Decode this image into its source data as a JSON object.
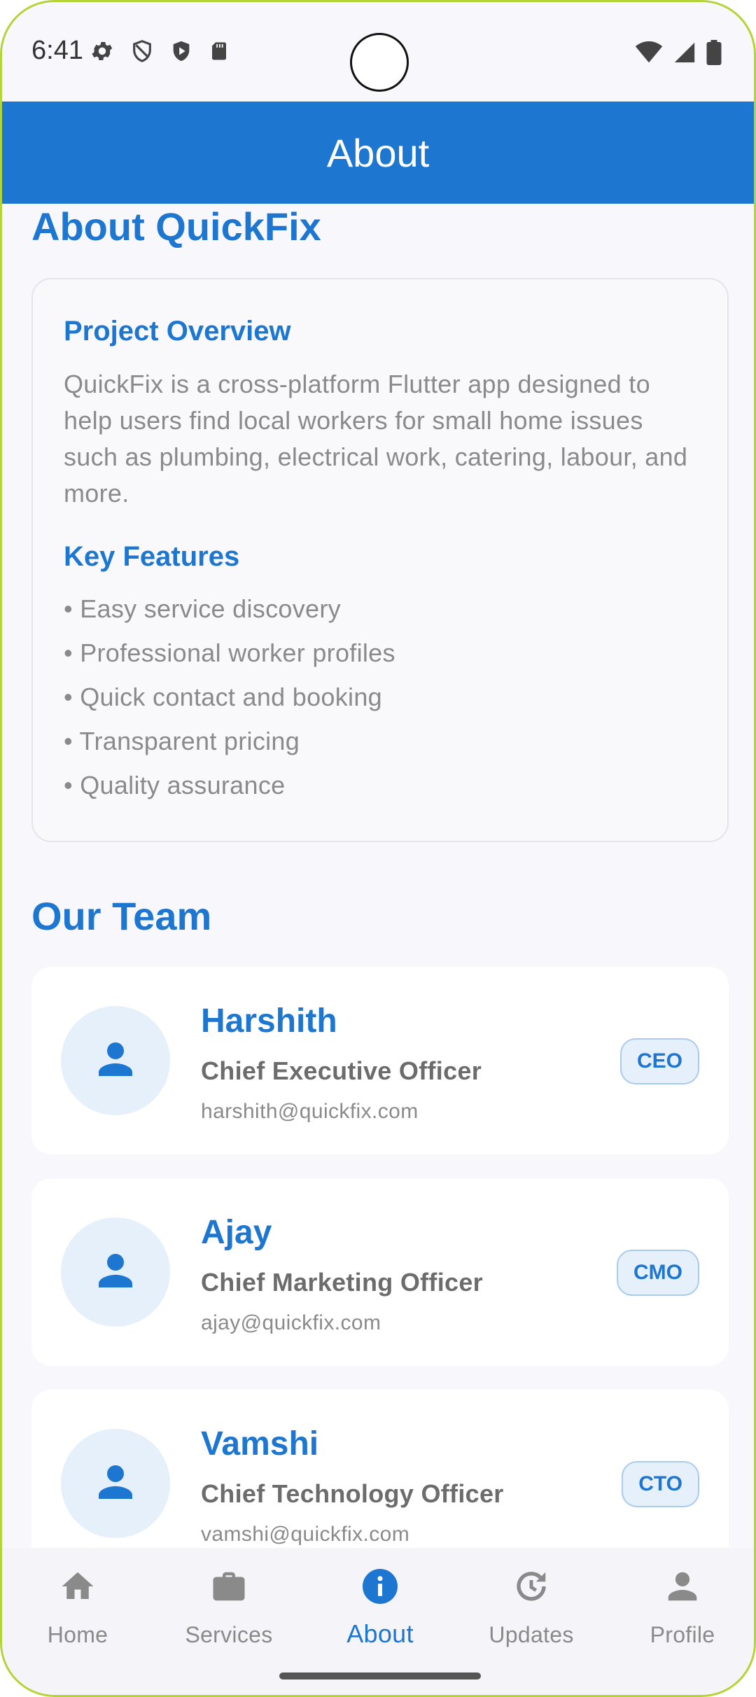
{
  "status_bar": {
    "time": "6:41"
  },
  "app_bar": {
    "title": "About"
  },
  "about": {
    "title": "About QuickFix",
    "overview_heading": "Project Overview",
    "overview_text": "QuickFix is a cross-platform Flutter app designed to help users find local workers for small home issues such as plumbing, electrical work, catering, labour, and more.",
    "features_heading": "Key Features",
    "features": [
      "• Easy service discovery",
      "• Professional worker profiles",
      "• Quick contact and booking",
      "• Transparent pricing",
      "• Quality assurance"
    ]
  },
  "team": {
    "title": "Our Team",
    "members": [
      {
        "name": "Harshith",
        "role": "Chief Executive Officer",
        "email": "harshith@quickfix.com",
        "badge": "CEO"
      },
      {
        "name": "Ajay",
        "role": "Chief Marketing Officer",
        "email": "ajay@quickfix.com",
        "badge": "CMO"
      },
      {
        "name": "Vamshi",
        "role": "Chief Technology Officer",
        "email": "vamshi@quickfix.com",
        "badge": "CTO"
      }
    ]
  },
  "bottom_nav": {
    "active": "About",
    "items": [
      {
        "label": "Home",
        "icon": "home-icon"
      },
      {
        "label": "Services",
        "icon": "briefcase-icon"
      },
      {
        "label": "About",
        "icon": "info-icon"
      },
      {
        "label": "Updates",
        "icon": "update-icon"
      },
      {
        "label": "Profile",
        "icon": "person-icon"
      }
    ]
  },
  "colors": {
    "primary": "#1d76cf",
    "text_muted": "#8a8a8a",
    "background": "#f7f7fc"
  }
}
